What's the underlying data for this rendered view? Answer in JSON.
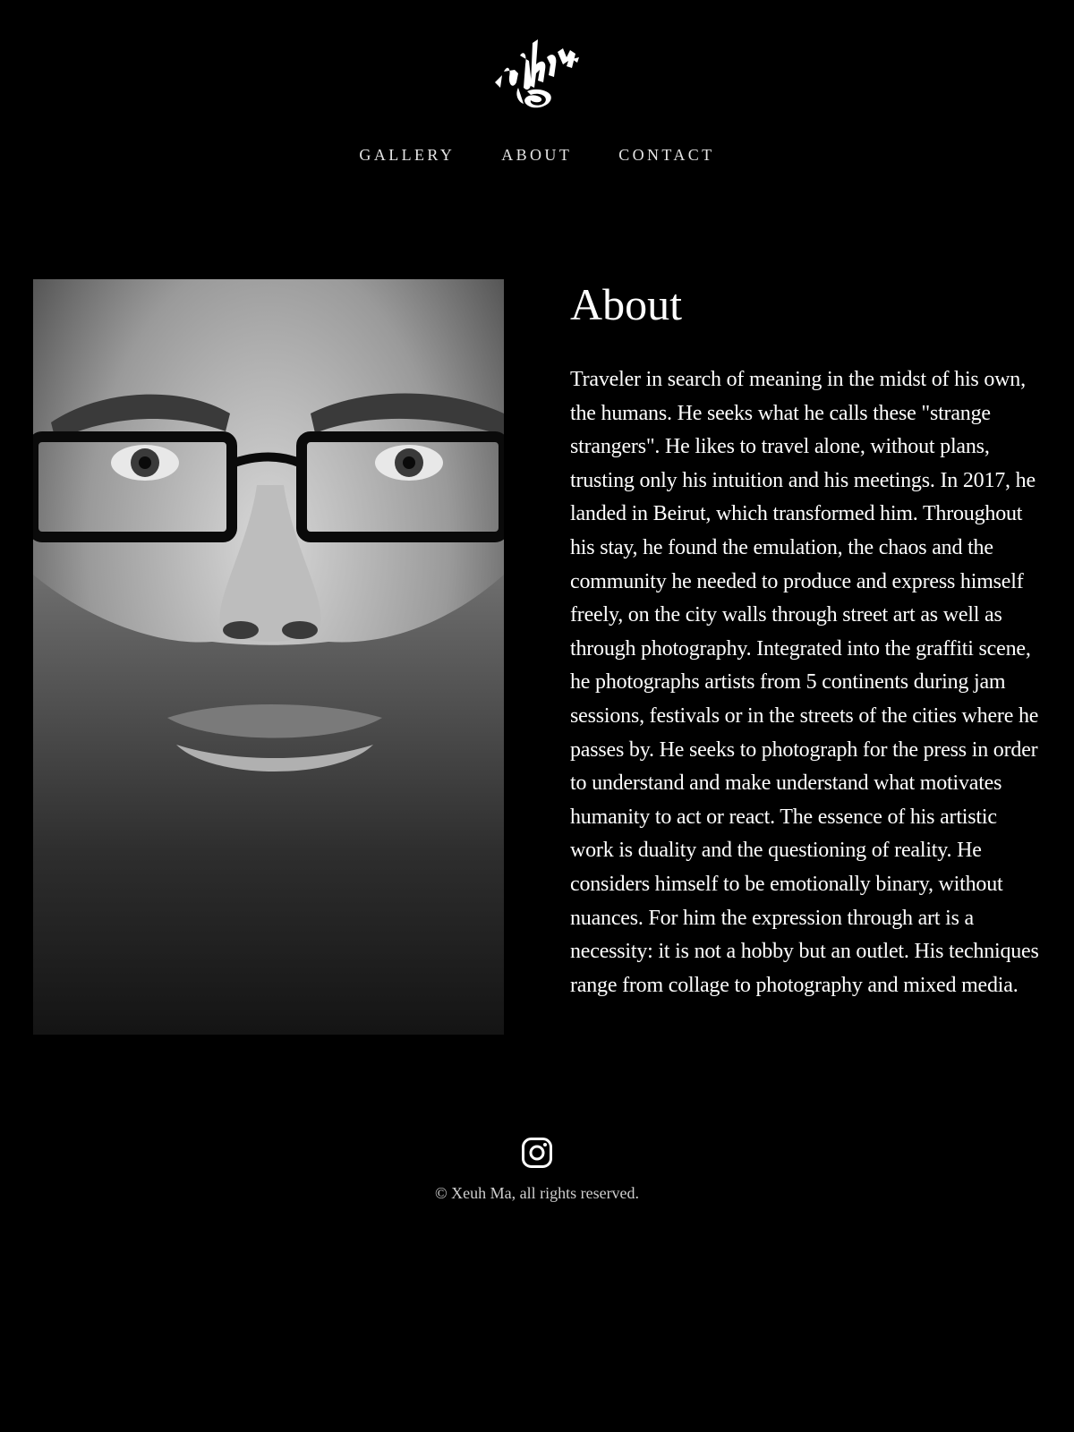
{
  "header": {
    "logo_alt": "Xeuh Ma",
    "nav": [
      {
        "label": "GALLERY"
      },
      {
        "label": "ABOUT"
      },
      {
        "label": "CONTACT"
      }
    ]
  },
  "main": {
    "title": "About",
    "body": "Traveler in search of meaning in the midst of his own, the humans. He seeks what he calls these \"strange strangers\". He likes to travel alone, without plans, trusting only his intuition and his meetings. In 2017, he landed in Beirut, which transformed him. Throughout his stay, he found the emulation, the chaos and the community he needed to produce and express himself freely, on the city walls through street art as well as through photography. Integrated into the graffiti scene, he photographs artists from 5 continents during jam sessions, festivals or in the streets of the cities where he passes by. He seeks to photograph for the press in order to understand and make understand what motivates humanity to act or react. The essence of his artistic work is duality and the questioning of reality. He considers himself to be emotionally binary, without nuances. For him the expression through art is a necessity: it is not a hobby but an outlet. His techniques range from collage to photography and mixed media.",
    "photo_icon": "portrait-photo"
  },
  "footer": {
    "social_icon": "instagram-icon",
    "copyright": "© Xeuh Ma, all rights reserved."
  },
  "colors": {
    "background": "#000000",
    "text": "#ffffff",
    "muted": "#cfcfcf"
  }
}
